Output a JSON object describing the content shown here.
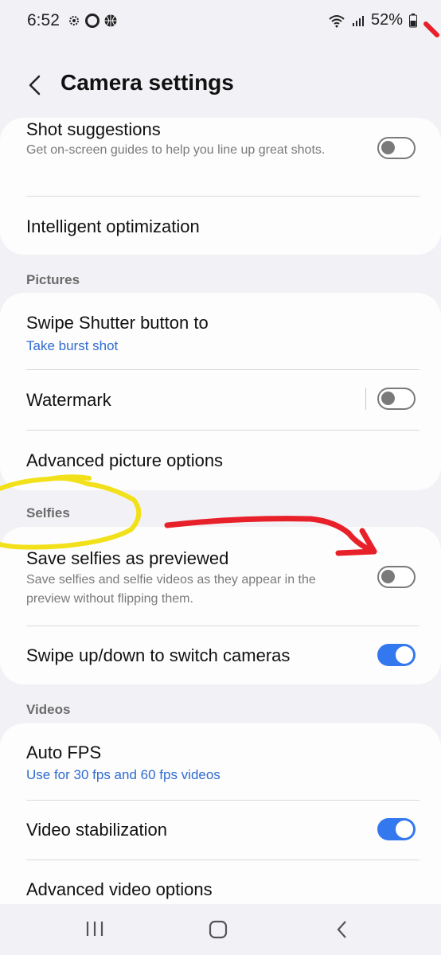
{
  "status": {
    "time": "6:52",
    "battery": "52%"
  },
  "header": {
    "title": "Camera settings"
  },
  "card1": {
    "shot_suggestions": {
      "title": "Shot suggestions",
      "subtitle": "Get on-screen guides to help you line up great shots.",
      "enabled": false
    },
    "intelligent_optimization": {
      "title": "Intelligent optimization"
    }
  },
  "pictures": {
    "label": "Pictures",
    "swipe_shutter": {
      "title": "Swipe Shutter button to",
      "value": "Take burst shot"
    },
    "watermark": {
      "title": "Watermark",
      "enabled": false
    },
    "advanced_picture": {
      "title": "Advanced picture options"
    }
  },
  "selfies": {
    "label": "Selfies",
    "save_selfies": {
      "title": "Save selfies as previewed",
      "subtitle": "Save selfies and selfie videos as they appear in the preview without flipping them.",
      "enabled": false
    },
    "swipe_switch": {
      "title": "Swipe up/down to switch cameras",
      "enabled": true
    }
  },
  "videos": {
    "label": "Videos",
    "auto_fps": {
      "title": "Auto FPS",
      "value": "Use for 30 fps and 60 fps videos"
    },
    "stabilization": {
      "title": "Video stabilization",
      "enabled": true
    },
    "advanced_video": {
      "title": "Advanced video options"
    }
  },
  "colors": {
    "accent": "#3478f0",
    "link": "#2f6bd0",
    "annotation_red": "#e8202a",
    "annotation_yellow": "#f2e11a"
  }
}
